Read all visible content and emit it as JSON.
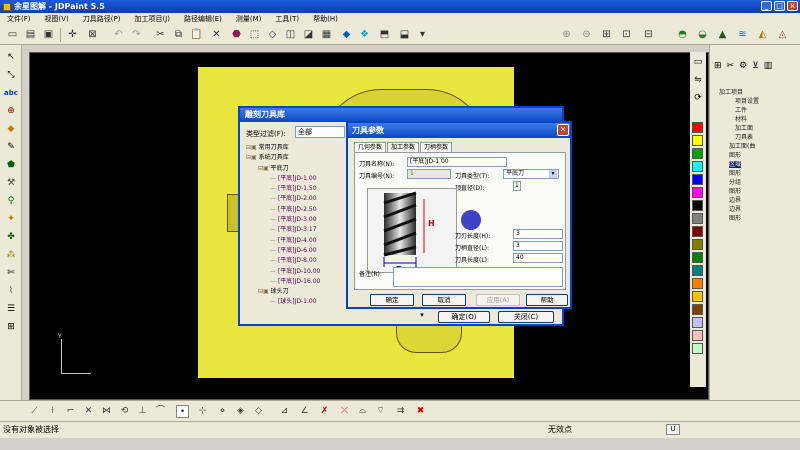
{
  "window": {
    "title": "余星图解 - JDPaint 5.5"
  },
  "menu": [
    "文件(F)",
    "视图(V)",
    "刀具路径(P)",
    "加工项目(J)",
    "路径编辑(E)",
    "测量(M)",
    "工具(T)",
    "帮助(H)"
  ],
  "toolbar_icons": [
    "new-file-icon",
    "open-folder-icon",
    "save-icon",
    "crosshair-icon",
    "select-box-icon",
    "undo-icon",
    "redo-icon",
    "cut-icon",
    "copy-icon",
    "paste-icon",
    "delete-icon",
    "shade-solid-icon",
    "view-box-icon",
    "view-iso-icon",
    "view-front-icon",
    "view-right-icon",
    "view-top-icon",
    "render-cube-icon",
    "layer-icon",
    "layer-alt-icon",
    "display-icon"
  ],
  "tool_library_dialog": {
    "title": "雕刻刀具库",
    "filter_label": "类型过滤(F):",
    "filter_value": "全部",
    "tree": [
      {
        "indent": 0,
        "text": "常用刀具库"
      },
      {
        "indent": 0,
        "text": "系统刀具库"
      },
      {
        "indent": 1,
        "text": "平底刀"
      },
      {
        "indent": 2,
        "text": "[平底]JD-1.00"
      },
      {
        "indent": 2,
        "text": "[平底]JD-1.50"
      },
      {
        "indent": 2,
        "text": "[平底]JD-2.00"
      },
      {
        "indent": 2,
        "text": "[平底]JD-2.50"
      },
      {
        "indent": 2,
        "text": "[平底]JD-3.00"
      },
      {
        "indent": 2,
        "text": "[平底]JD-3.17"
      },
      {
        "indent": 2,
        "text": "[平底]JD-4.00"
      },
      {
        "indent": 2,
        "text": "[平底]JD-6.00"
      },
      {
        "indent": 2,
        "text": "[平底]JD-8.00"
      },
      {
        "indent": 2,
        "text": "[平底]JD-10.00"
      },
      {
        "indent": 2,
        "text": "[平底]JD-16.00"
      },
      {
        "indent": 1,
        "text": "球头刀"
      },
      {
        "indent": 2,
        "text": "[球头]JD-1.00"
      }
    ],
    "ok": "确定(O)",
    "close": "关闭(C)"
  },
  "tool_params_dialog": {
    "title": "刀具参数",
    "tabs": [
      "几何参数",
      "加工参数",
      "刀柄参数"
    ],
    "name_label": "刀具名称(N):",
    "name_value": "[平底]JD-1.00",
    "number_label": "刀具编号(N):",
    "number_value": "1",
    "type_label": "刀具类型(T):",
    "type_value": "平底刀",
    "top_diameter_label": "顶直径(D):",
    "top_diameter_value": "1",
    "dim_d": "D",
    "dim_h": "H",
    "edge_length_label": "刀刃长度(H):",
    "edge_length_value": "3",
    "shank_diameter_label": "刀柄直径(L):",
    "shank_diameter_value": "3",
    "tool_length_label": "刀具长度(L):",
    "tool_length_value": "40",
    "note_label": "备注(R):",
    "buttons": {
      "ok": "确定",
      "cancel": "取消",
      "apply": "应用(A)",
      "help": "帮助"
    }
  },
  "right_tree": [
    {
      "text": "加工项目",
      "hl": false
    },
    {
      "text": "项目设置",
      "hl": false
    },
    {
      "text": "工件",
      "hl": false
    },
    {
      "text": "材料",
      "hl": false
    },
    {
      "text": "加工面",
      "hl": false
    },
    {
      "text": "刀具表",
      "hl": false
    },
    {
      "text": "加工面(曲",
      "hl": false
    },
    {
      "text": "图形",
      "hl": false
    },
    {
      "text": "区域",
      "hl": true
    },
    {
      "text": "图形",
      "hl": false
    },
    {
      "text": "分组",
      "hl": false
    },
    {
      "text": "图形",
      "hl": false
    },
    {
      "text": "边界",
      "hl": false
    },
    {
      "text": "边界",
      "hl": false
    },
    {
      "text": "图形",
      "hl": false
    }
  ],
  "palette": [
    "#ff0000",
    "#ffff00",
    "#00a000",
    "#00ffff",
    "#0000ff",
    "#ff00ff",
    "#000000",
    "#808080",
    "#800000",
    "#808000",
    "#008000",
    "#008080",
    "#ff8000",
    "#ffc000",
    "#804000",
    "#c0c0ff",
    "#ffc0c0",
    "#c0ffc0"
  ],
  "status": {
    "message": "没有对象被选择",
    "snap": "无效点",
    "unit_button": "U"
  },
  "colors": {
    "workpiece": "#e8e63c",
    "canvas": "#000000",
    "title_bar": "#0a3db5"
  }
}
